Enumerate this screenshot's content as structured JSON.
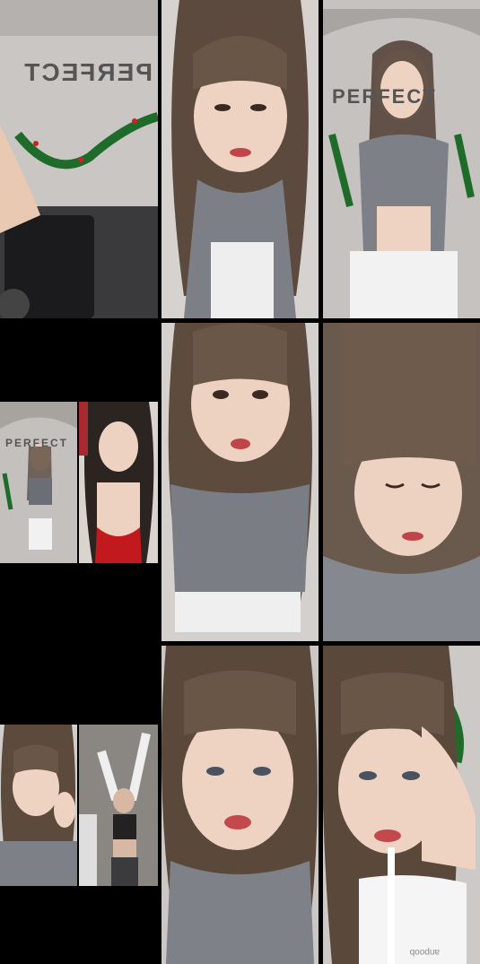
{
  "grid": {
    "background": "#000000",
    "tiles": [
      {
        "name": "tile-office-room",
        "wall_sign": "PERFECT"
      },
      {
        "name": "tile-face-closeup-1"
      },
      {
        "name": "tile-dancer-standing",
        "wall_sign": "PERFECT"
      },
      {
        "name": "tile-face-closeup-2"
      },
      {
        "name": "tile-face-closeup-3"
      },
      {
        "name": "tile-face-closeup-4"
      },
      {
        "name": "tile-face-closeup-5"
      }
    ],
    "mini_tiles": [
      {
        "name": "mini-dancer-room",
        "wall_sign": "PERFECT"
      },
      {
        "name": "mini-red-outfit"
      },
      {
        "name": "mini-face-hands"
      },
      {
        "name": "mini-arms-raised"
      }
    ]
  },
  "cup_label": "anpoob"
}
